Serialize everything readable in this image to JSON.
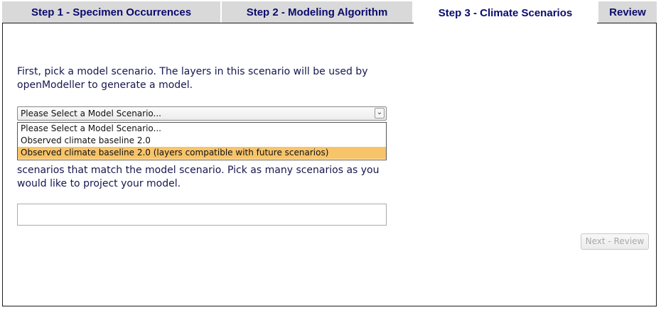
{
  "tabs": [
    {
      "label": "Step 1 - Specimen Occurrences"
    },
    {
      "label": "Step 2 - Modeling Algorithm"
    },
    {
      "label": "Step 3 - Climate Scenarios"
    },
    {
      "label": "Review"
    }
  ],
  "active_tab": "Step 3 - Climate Scenarios",
  "instructions": {
    "pick_model": "First, pick a model scenario. The layers in this scenario will be used by openModeller to generate a model.",
    "pick_projection": "scenarios that match the model scenario. Pick as many scenarios as you would like to project your model."
  },
  "model_select": {
    "selected": "Please Select a Model Scenario...",
    "options": [
      "Please Select a Model Scenario...",
      "Observed climate baseline 2.0",
      "Observed climate baseline 2.0 (layers compatible with future scenarios)"
    ],
    "highlighted_index": 2
  },
  "buttons": {
    "next": "Next - Review"
  },
  "colors": {
    "tab_text": "#0a0a6e",
    "tab_inactive_bg": "#d9d9d9",
    "highlight": "#f7c46a",
    "text": "#161650"
  }
}
